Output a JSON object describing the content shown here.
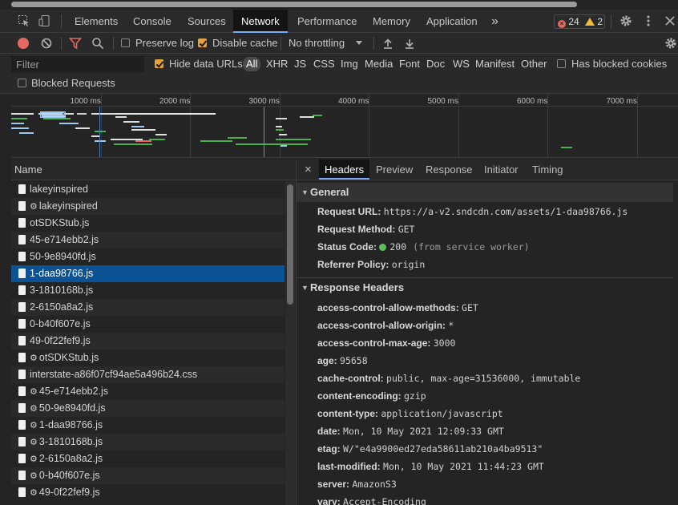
{
  "main_tabs": [
    "Elements",
    "Console",
    "Sources",
    "Network",
    "Performance",
    "Memory",
    "Application"
  ],
  "active_tab": "Network",
  "more_tabs_glyph": "»",
  "error_count": "24",
  "warning_count": "2",
  "toolbar": {
    "preserve_log_label": "Preserve log",
    "preserve_log_checked": false,
    "disable_cache_label": "Disable cache",
    "disable_cache_checked": true,
    "throttling_value": "No throttling"
  },
  "filter": {
    "placeholder": "Filter",
    "hide_data_urls_label": "Hide data URLs",
    "hide_data_urls_checked": true,
    "types": [
      "All",
      "XHR",
      "JS",
      "CSS",
      "Img",
      "Media",
      "Font",
      "Doc",
      "WS",
      "Manifest",
      "Other"
    ],
    "active_type": "All",
    "has_blocked_cookies_label": "Has blocked cookies",
    "blocked_requests_label": "Blocked Requests"
  },
  "overview": {
    "ticks": [
      "1000 ms",
      "2000 ms",
      "3000 ms",
      "4000 ms",
      "5000 ms",
      "6000 ms",
      "7000 ms"
    ]
  },
  "request_list": {
    "header": "Name",
    "rows": [
      {
        "name": "lakeyinspired",
        "sw": false
      },
      {
        "name": "lakeyinspired",
        "sw": true
      },
      {
        "name": "otSDKStub.js",
        "sw": false
      },
      {
        "name": "45-e714ebb2.js",
        "sw": false
      },
      {
        "name": "50-9e8940fd.js",
        "sw": false
      },
      {
        "name": "1-daa98766.js",
        "sw": false
      },
      {
        "name": "3-1810168b.js",
        "sw": false
      },
      {
        "name": "2-6150a8a2.js",
        "sw": false
      },
      {
        "name": "0-b40f607e.js",
        "sw": false
      },
      {
        "name": "49-0f22fef9.js",
        "sw": false
      },
      {
        "name": "otSDKStub.js",
        "sw": true
      },
      {
        "name": "interstate-a86f07cf94ae5a496b24.css",
        "sw": false
      },
      {
        "name": "45-e714ebb2.js",
        "sw": true
      },
      {
        "name": "50-9e8940fd.js",
        "sw": true
      },
      {
        "name": "1-daa98766.js",
        "sw": true
      },
      {
        "name": "3-1810168b.js",
        "sw": true
      },
      {
        "name": "2-6150a8a2.js",
        "sw": true
      },
      {
        "name": "0-b40f607e.js",
        "sw": true
      },
      {
        "name": "49-0f22fef9.js",
        "sw": true
      }
    ],
    "selected_index": 5
  },
  "detail": {
    "close_glyph": "×",
    "tabs": [
      "Headers",
      "Preview",
      "Response",
      "Initiator",
      "Timing"
    ],
    "active_tab": "Headers",
    "general": {
      "title": "General",
      "items": [
        {
          "key": "Request URL:",
          "value": "https://a-v2.sndcdn.com/assets/1-daa98766.js"
        },
        {
          "key": "Request Method:",
          "value": "GET"
        },
        {
          "key": "Status Code:",
          "value": "200",
          "note": "(from service worker)"
        },
        {
          "key": "Referrer Policy:",
          "value": "origin"
        }
      ]
    },
    "response_headers": {
      "title": "Response Headers",
      "items": [
        {
          "key": "access-control-allow-methods:",
          "value": "GET"
        },
        {
          "key": "access-control-allow-origin:",
          "value": "*"
        },
        {
          "key": "access-control-max-age:",
          "value": "3000"
        },
        {
          "key": "age:",
          "value": "95658"
        },
        {
          "key": "cache-control:",
          "value": "public, max-age=31536000, immutable"
        },
        {
          "key": "content-encoding:",
          "value": "gzip"
        },
        {
          "key": "content-type:",
          "value": "application/javascript"
        },
        {
          "key": "date:",
          "value": "Mon, 10 May 2021 12:09:33 GMT"
        },
        {
          "key": "etag:",
          "value": "W/\"e4a9900ed27eda58611ab210a4ba9513\""
        },
        {
          "key": "last-modified:",
          "value": "Mon, 10 May 2021 11:44:23 GMT"
        },
        {
          "key": "server:",
          "value": "AmazonS3"
        },
        {
          "key": "vary:",
          "value": "Accept-Encoding"
        }
      ]
    }
  }
}
